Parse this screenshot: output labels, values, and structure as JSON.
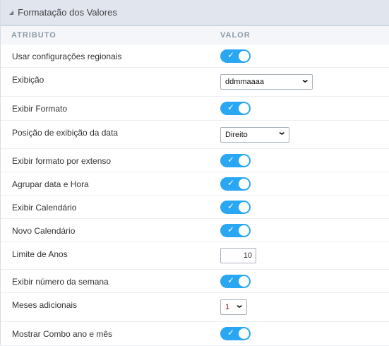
{
  "panel": {
    "title": "Formatação dos Valores",
    "col_attr": "ATRIBUTO",
    "col_value": "VALOR"
  },
  "colors": {
    "toggle_on": "#29a7f3"
  },
  "rows": [
    {
      "label": "Usar configurações regionais",
      "type": "toggle",
      "value": true
    },
    {
      "label": "Exibição",
      "type": "select",
      "value": "ddmmaaaa"
    },
    {
      "label": "Exibir Formato",
      "type": "toggle",
      "value": true
    },
    {
      "label": "Posição de exibição da data",
      "type": "select",
      "value": "Direito"
    },
    {
      "label": "Exibir formato por extenso",
      "type": "toggle",
      "value": true
    },
    {
      "label": "Agrupar data e Hora",
      "type": "toggle",
      "value": true
    },
    {
      "label": "Exibir Calendário",
      "type": "toggle",
      "value": true
    },
    {
      "label": "Novo Calendário",
      "type": "toggle",
      "value": true
    },
    {
      "label": "Limite de Anos",
      "type": "input",
      "value": "10"
    },
    {
      "label": "Exibir número da semana",
      "type": "toggle",
      "value": true
    },
    {
      "label": "Meses adicionais",
      "type": "select",
      "value": "1"
    },
    {
      "label": "Mostrar Combo ano e mês",
      "type": "toggle",
      "value": true
    }
  ]
}
